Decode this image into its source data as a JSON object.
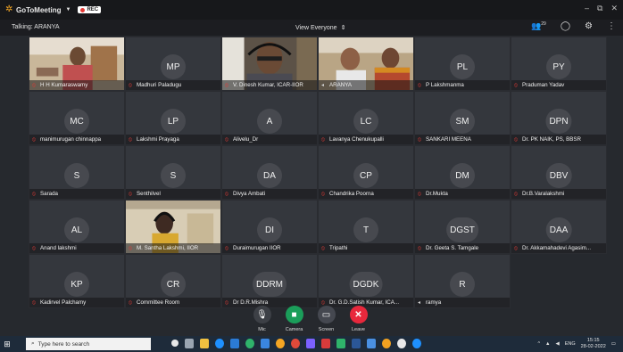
{
  "window": {
    "app_name": "GoToMeeting",
    "recording_label": "REC",
    "controls": [
      "–",
      "⧉",
      "✕"
    ]
  },
  "subbar": {
    "talking": "Talking: ARANYA",
    "view_select": "View Everyone",
    "participant_count": "29"
  },
  "participants": [
    {
      "initials": "",
      "name": "H H Kumaraswamy",
      "video": true,
      "muted": true
    },
    {
      "initials": "MP",
      "name": "Madhuri Paladugu",
      "video": false,
      "muted": true
    },
    {
      "initials": "",
      "name": "V. Dinesh Kumar, ICAR-IIOR",
      "video": true,
      "muted": true
    },
    {
      "initials": "",
      "name": "ARANYA",
      "video": true,
      "muted": false
    },
    {
      "initials": "PL",
      "name": "P Lakshmanma",
      "video": false,
      "muted": true
    },
    {
      "initials": "PY",
      "name": "Praduman Yadav",
      "video": false,
      "muted": true
    },
    {
      "initials": "MC",
      "name": "manimurugan chinnappa",
      "video": false,
      "muted": true
    },
    {
      "initials": "LP",
      "name": "Lakshmi Prayaga",
      "video": false,
      "muted": true
    },
    {
      "initials": "A",
      "name": "Alivelu_Dr",
      "video": false,
      "muted": true
    },
    {
      "initials": "LC",
      "name": "Lavanya Chenukupalli",
      "video": false,
      "muted": true
    },
    {
      "initials": "SM",
      "name": "SANKARI MEENA",
      "video": false,
      "muted": true
    },
    {
      "initials": "DPN",
      "name": "Dr. PK NAIK, PS, BBSR",
      "video": false,
      "muted": true
    },
    {
      "initials": "S",
      "name": "Sarada",
      "video": false,
      "muted": true
    },
    {
      "initials": "S",
      "name": "Senthilvel",
      "video": false,
      "muted": true
    },
    {
      "initials": "DA",
      "name": "Divya Ambati",
      "video": false,
      "muted": true
    },
    {
      "initials": "CP",
      "name": "Chandrika Poorna",
      "video": false,
      "muted": true
    },
    {
      "initials": "DM",
      "name": "Dr.Mukta",
      "video": false,
      "muted": true
    },
    {
      "initials": "DBV",
      "name": "Dr.B.Varalakshmi",
      "video": false,
      "muted": true
    },
    {
      "initials": "AL",
      "name": "Anand lakshmi",
      "video": false,
      "muted": true
    },
    {
      "initials": "",
      "name": "M. Santha Lakshmi, IIOR",
      "video": true,
      "muted": true
    },
    {
      "initials": "DI",
      "name": "Duraimurugan IIOR",
      "video": false,
      "muted": true
    },
    {
      "initials": "T",
      "name": "Tripathi",
      "video": false,
      "muted": true
    },
    {
      "initials": "DGST",
      "name": "Dr. Geeta S. Tamgale",
      "video": false,
      "muted": true
    },
    {
      "initials": "DAA",
      "name": "Dr. Akkamahadevi Agasim...",
      "video": false,
      "muted": true
    },
    {
      "initials": "KP",
      "name": "Kadirvel Palchamy",
      "video": false,
      "muted": true
    },
    {
      "initials": "CR",
      "name": "Committee Room",
      "video": false,
      "muted": true
    },
    {
      "initials": "DDRM",
      "name": "Dr D.R.Mishra",
      "video": false,
      "muted": true
    },
    {
      "initials": "DGDK",
      "name": "Dr. G.D.Satish Kumar, ICA...",
      "video": false,
      "muted": true
    },
    {
      "initials": "R",
      "name": "ramya",
      "video": false,
      "muted": false
    }
  ],
  "controls": {
    "mic": "Mic",
    "camera": "Camera",
    "screen": "Screen",
    "leave": "Leave"
  },
  "taskbar": {
    "search_placeholder": "Type here to search",
    "language": "ENG",
    "time": "15:15",
    "date": "28-02-2022"
  },
  "colors": {
    "accent_camera": "#1b9e5a",
    "leave": "#e8283c",
    "muted": "#e53935",
    "logo": "#f5a623"
  }
}
